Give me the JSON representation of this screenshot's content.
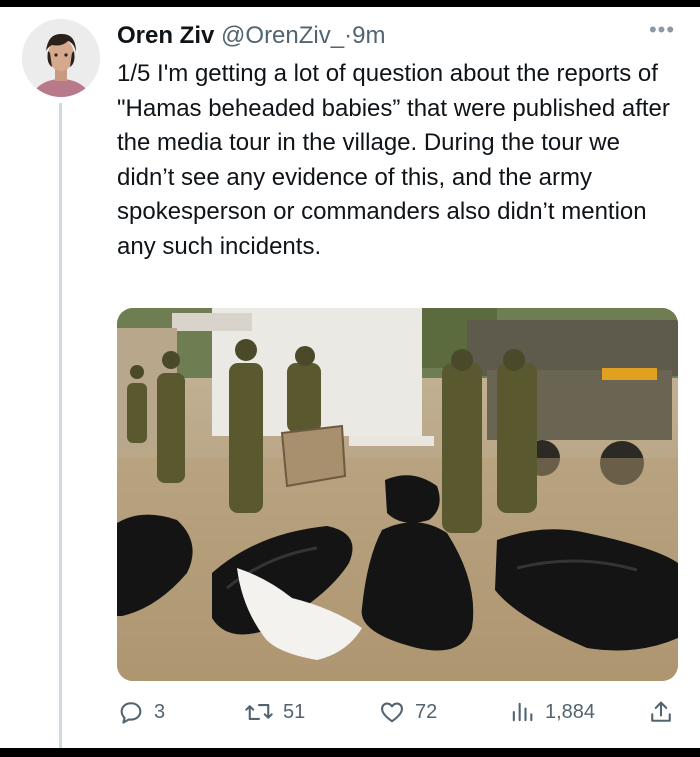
{
  "tweet": {
    "author_name": "Oren Ziv",
    "handle": "@OrenZiv_",
    "separator": "·",
    "time": "9m",
    "more_label": "•••",
    "text": "1/5 I'm getting a lot of question about the reports of \"Hamas beheaded babies” that were published after the media tour in the village. During the tour we didn’t see any evidence of this, and the army spokesperson or commanders also didn’t mention any such incidents."
  },
  "media": {
    "icon": "photo"
  },
  "actions": {
    "replies": "3",
    "reposts": "51",
    "likes": "72",
    "views": "1,884",
    "icons": [
      "reply-icon",
      "repost-icon",
      "like-icon",
      "views-icon",
      "share-icon"
    ]
  },
  "colors": {
    "text": "#0f1419",
    "secondary": "#536471",
    "thread_line": "#cfd9de",
    "frame": "#000000"
  }
}
